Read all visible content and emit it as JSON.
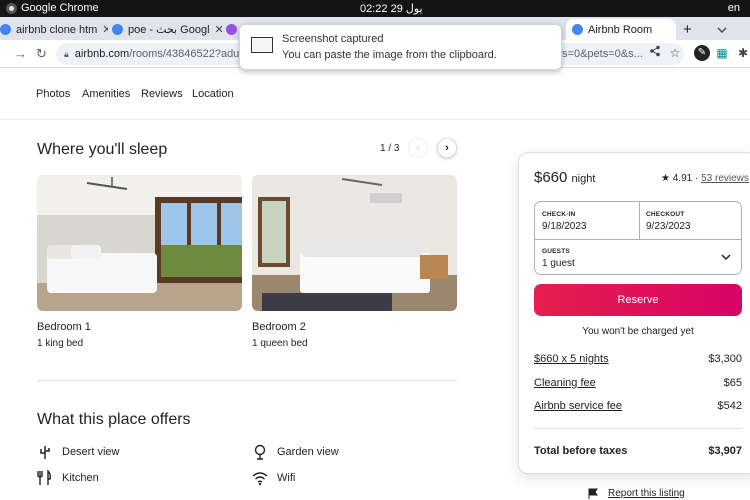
{
  "os": {
    "app_name": "Google Chrome",
    "clock": "02:22  29 يول",
    "lang": "en"
  },
  "tabs": [
    {
      "title": "airbnb clone htm",
      "color": "#4285f4"
    },
    {
      "title": "poe - بحث Googl",
      "color": "#4285f4"
    },
    {
      "title": "",
      "color": "#9b51e0"
    },
    {
      "title": "Airbnb Room",
      "color": "#4285f4"
    }
  ],
  "tab_new": "+",
  "address": {
    "host": "airbnb.com",
    "path": "/rooms/43846522?adults=18",
    "path_tail": "ts=0&pets=0&s..."
  },
  "notification": {
    "title": "Screenshot captured",
    "body": "You can paste the image from the clipboard."
  },
  "subnav": [
    "Photos",
    "Amenities",
    "Reviews",
    "Location"
  ],
  "sleep": {
    "heading": "Where you'll sleep",
    "pager": "1 / 3",
    "bedrooms": [
      {
        "name": "Bedroom 1",
        "beds": "1 king bed"
      },
      {
        "name": "Bedroom 2",
        "beds": "1 queen bed"
      }
    ]
  },
  "offers": {
    "heading": "What this place offers",
    "items": [
      {
        "label": "Desert view",
        "icon": "cactus-icon"
      },
      {
        "label": "Garden view",
        "icon": "tree-icon"
      },
      {
        "label": "Kitchen",
        "icon": "utensils-icon"
      },
      {
        "label": "Wifi",
        "icon": "wifi-icon"
      }
    ]
  },
  "card": {
    "price": "$660",
    "per": "night",
    "rating": "★ 4.91 ·",
    "reviews": "53 reviews",
    "checkin_label": "CHECK-IN",
    "checkin": "9/18/2023",
    "checkout_label": "CHECKOUT",
    "checkout": "9/23/2023",
    "guests_label": "GUESTS",
    "guests": "1 guest",
    "reserve": "Reserve",
    "no_charge": "You won't be charged yet",
    "fees": [
      {
        "label": "$660 x 5 nights",
        "value": "$3,300"
      },
      {
        "label": "Cleaning fee",
        "value": "$65"
      },
      {
        "label": "Airbnb service fee",
        "value": "$542"
      }
    ],
    "total_label": "Total before taxes",
    "total": "$3,907"
  },
  "report": "Report this listing",
  "colors": {
    "brand": "#e61e4d",
    "osbar": "#141414",
    "tabbar": "#dfe3eb"
  }
}
